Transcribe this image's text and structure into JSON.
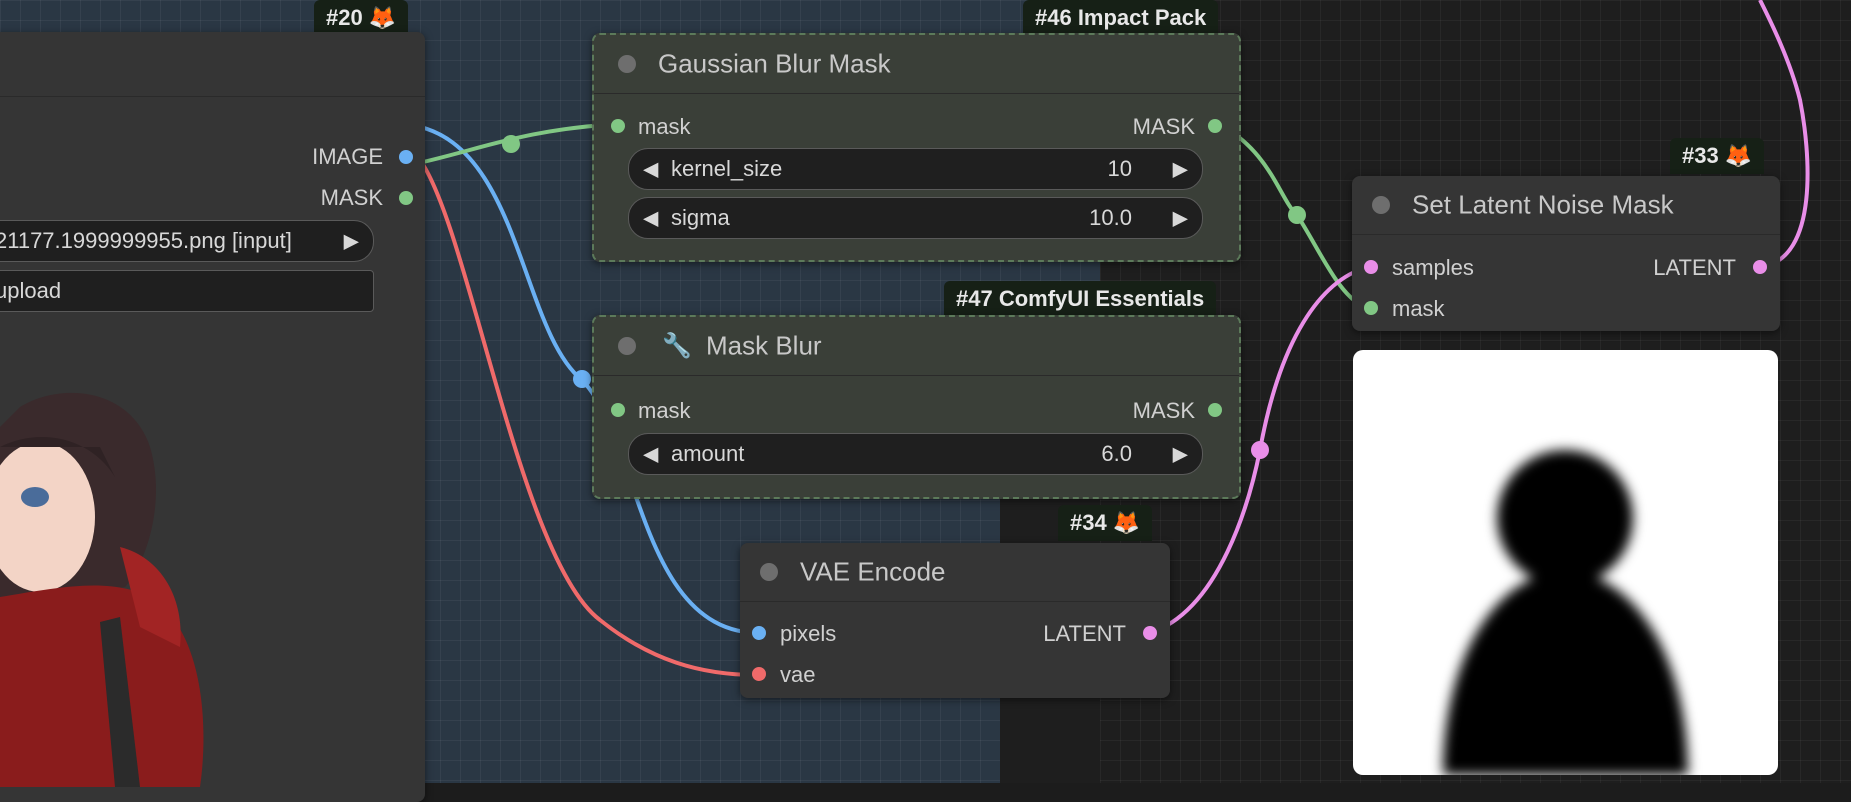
{
  "nodes": {
    "load_image": {
      "badge": "#20",
      "badge_icon": "🦊",
      "outputs": [
        "IMAGE",
        "MASK"
      ],
      "image_field": "21177.1999999955.png [input]",
      "upload_label": "upload"
    },
    "gaussian_blur": {
      "badge": "#46 Impact Pack",
      "title": "Gaussian Blur Mask",
      "input": "mask",
      "output": "MASK",
      "widgets": [
        {
          "label": "kernel_size",
          "value": "10"
        },
        {
          "label": "sigma",
          "value": "10.0"
        }
      ]
    },
    "mask_blur": {
      "badge": "#47 ComfyUI Essentials",
      "title": "Mask Blur",
      "title_icon": "🔧",
      "input": "mask",
      "output": "MASK",
      "widgets": [
        {
          "label": "amount",
          "value": "6.0"
        }
      ]
    },
    "vae_encode": {
      "badge": "#34",
      "badge_icon": "🦊",
      "title": "VAE Encode",
      "inputs": [
        "pixels",
        "vae"
      ],
      "output": "LATENT"
    },
    "set_latent_noise_mask": {
      "badge": "#33",
      "badge_icon": "🦊",
      "title": "Set Latent Noise Mask",
      "inputs": [
        "samples",
        "mask"
      ],
      "output": "LATENT"
    }
  },
  "colors": {
    "image": "#6ab0f3",
    "mask": "#81c784",
    "latent": "#e98ee8",
    "vae": "#f06a6a"
  },
  "icons": {
    "left_arrow": "◀",
    "right_arrow": "▶"
  }
}
